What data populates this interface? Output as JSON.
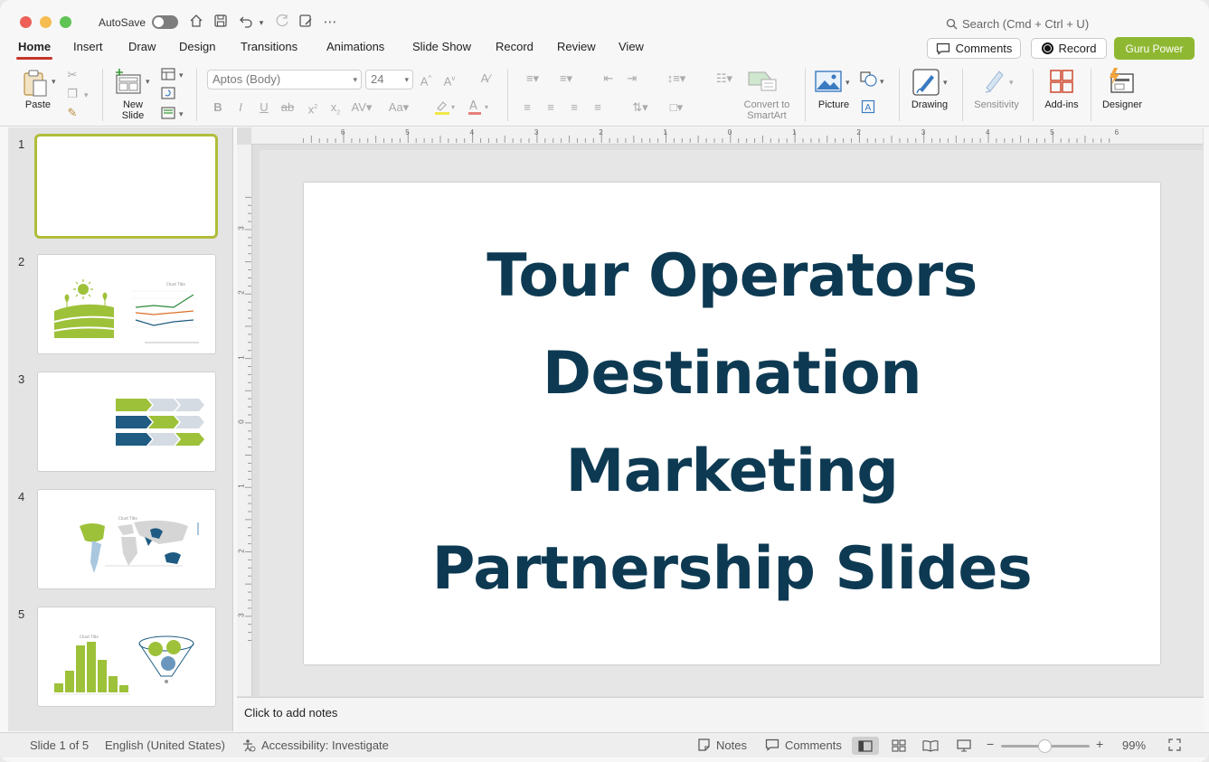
{
  "titlebar": {
    "autosave_label": "AutoSave",
    "search_placeholder": "Search (Cmd + Ctrl + U)"
  },
  "tabs": [
    "Home",
    "Insert",
    "Draw",
    "Design",
    "Transitions",
    "Animations",
    "Slide Show",
    "Record",
    "Review",
    "View"
  ],
  "header_buttons": {
    "comments": "Comments",
    "record": "Record",
    "guru": "Guru Power"
  },
  "ribbon": {
    "paste": "Paste",
    "new_slide_line1": "New",
    "new_slide_line2": "Slide",
    "font_name": "Aptos (Body)",
    "font_size": "24",
    "convert_line1": "Convert to",
    "convert_line2": "SmartArt",
    "picture": "Picture",
    "drawing": "Drawing",
    "sensitivity": "Sensitivity",
    "addins": "Add-ins",
    "designer": "Designer"
  },
  "ruler": {
    "h_ticks": [
      "6",
      "5",
      "4",
      "3",
      "2",
      "1",
      "0",
      "1",
      "2",
      "3",
      "4",
      "5",
      "6"
    ],
    "v_ticks": [
      "3",
      "2",
      "1",
      "0",
      "1",
      "2",
      "3"
    ]
  },
  "thumbnails": [
    {
      "num": "1"
    },
    {
      "num": "2",
      "chart_title": "Chart Title"
    },
    {
      "num": "3"
    },
    {
      "num": "4",
      "chart_title": "Chart Title"
    },
    {
      "num": "5",
      "chart_title": "Chart Title"
    }
  ],
  "slide": {
    "title_lines": [
      "Tour Operators",
      "Destination",
      "Marketing",
      "Partnership Slides"
    ],
    "title_color": "#0d3a52"
  },
  "notes_placeholder": "Click to add notes",
  "status": {
    "slide_count": "Slide 1 of 5",
    "language": "English (United States)",
    "accessibility": "Accessibility: Investigate",
    "notes": "Notes",
    "comments": "Comments",
    "zoom": "99%"
  },
  "colors": {
    "accent_green": "#8fb832",
    "dark_blue": "#0d3a52",
    "tab_underline": "#c4372b"
  }
}
